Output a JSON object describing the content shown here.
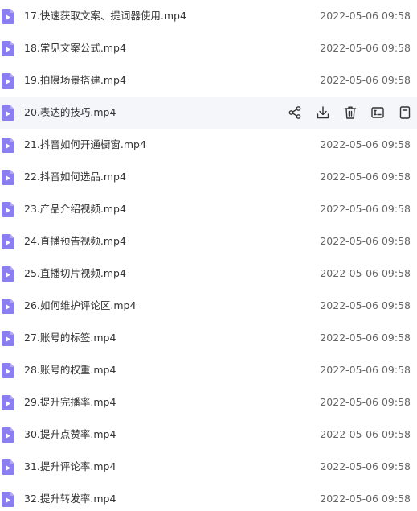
{
  "colors": {
    "icon_purple": "#8b7ff0",
    "icon_purple_light": "#b3aaf7",
    "hover_bg": "#f5f6fa",
    "text": "#333333",
    "date_text": "#666666"
  },
  "files": [
    {
      "name": "17.快速获取文案、提词器使用.mp4",
      "date": "2022-05-06 09:58",
      "hovered": false
    },
    {
      "name": "18.常见文案公式.mp4",
      "date": "2022-05-06 09:58",
      "hovered": false
    },
    {
      "name": "19.拍摄场景搭建.mp4",
      "date": "2022-05-06 09:58",
      "hovered": false
    },
    {
      "name": "20.表达的技巧.mp4",
      "date": "",
      "hovered": true
    },
    {
      "name": "21.抖音如何开通橱窗.mp4",
      "date": "2022-05-06 09:58",
      "hovered": false
    },
    {
      "name": "22.抖音如何选品.mp4",
      "date": "2022-05-06 09:58",
      "hovered": false
    },
    {
      "name": "23.产品介绍视频.mp4",
      "date": "2022-05-06 09:58",
      "hovered": false
    },
    {
      "name": "24.直播预告视频.mp4",
      "date": "2022-05-06 09:58",
      "hovered": false
    },
    {
      "name": "25.直播切片视频.mp4",
      "date": "2022-05-06 09:58",
      "hovered": false
    },
    {
      "name": "26.如何维护评论区.mp4",
      "date": "2022-05-06 09:58",
      "hovered": false
    },
    {
      "name": "27.账号的标签.mp4",
      "date": "2022-05-06 09:58",
      "hovered": false
    },
    {
      "name": "28.账号的权重.mp4",
      "date": "2022-05-06 09:58",
      "hovered": false
    },
    {
      "name": "29.提升完播率.mp4",
      "date": "2022-05-06 09:58",
      "hovered": false
    },
    {
      "name": "30.提升点赞率.mp4",
      "date": "2022-05-06 09:58",
      "hovered": false
    },
    {
      "name": "31.提升评论率.mp4",
      "date": "2022-05-06 09:58",
      "hovered": false
    },
    {
      "name": "32.提升转发率.mp4",
      "date": "2022-05-06 09:58",
      "hovered": false
    }
  ],
  "row_actions": [
    "share-icon",
    "download-icon",
    "delete-icon",
    "rename-icon",
    "more-icon"
  ]
}
